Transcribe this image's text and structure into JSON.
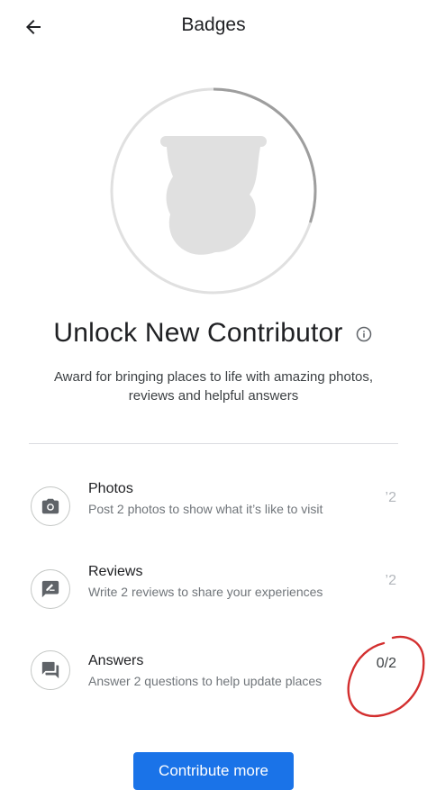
{
  "header": {
    "title": "Badges",
    "back_icon": "arrow-back-icon"
  },
  "badge": {
    "title": "Unlock New Contributor",
    "info_icon": "info-icon",
    "description": "Award for bringing places to life with amazing photos, reviews and helpful answers",
    "progress_ring": 0.3,
    "ring_color": "#9e9e9e",
    "silhouette_color": "#e0e0e0"
  },
  "tasks": [
    {
      "name": "Photos",
      "description": "Post 2 photos to show what it’s like to visit",
      "count": "’2",
      "icon": "camera-icon"
    },
    {
      "name": "Reviews",
      "description": "Write 2 reviews to share your experiences",
      "count": "’2",
      "icon": "review-edit-icon"
    },
    {
      "name": "Answers",
      "description": "Answer 2 questions to help update places",
      "count": "0/2",
      "icon": "answers-chat-icon"
    }
  ],
  "cta": {
    "label": "Contribute more",
    "color": "#1a73e8"
  },
  "annotation": {
    "color": "#d32f2f"
  }
}
